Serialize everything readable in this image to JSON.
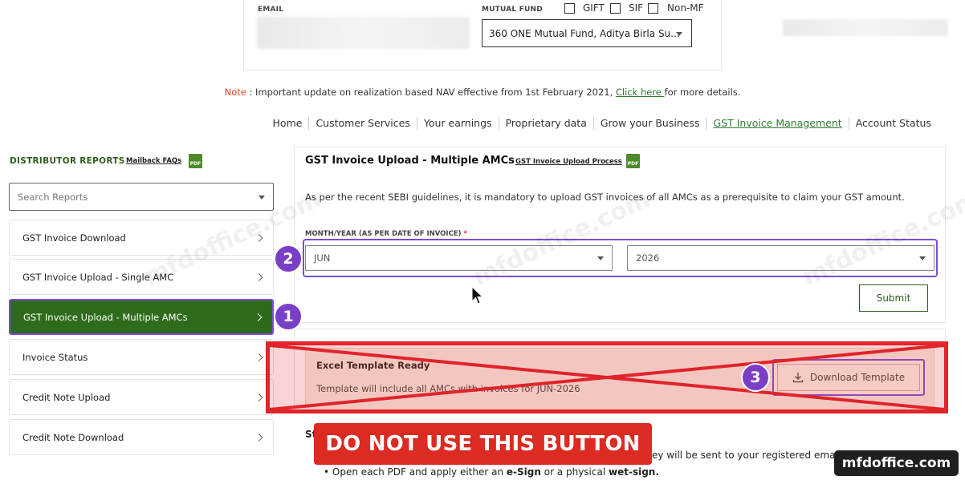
{
  "filters": {
    "email_label": "EMAIL",
    "mutual_fund_label": "MUTUAL FUND",
    "checkboxes": [
      "GIFT",
      "SIF",
      "Non-MF"
    ],
    "mutual_fund_value": "360 ONE Mutual Fund, Aditya Birla Su..."
  },
  "note": {
    "prefix": "Note",
    "text": " : Important update on realization based NAV effective from 1st February 2021, ",
    "link": "Click here ",
    "suffix": "for more details."
  },
  "nav": {
    "items": [
      "Home",
      "Customer Services",
      "Your earnings",
      "Proprietary data",
      "Grow your Business",
      "GST Invoice Management",
      "Account Status"
    ],
    "active": "GST Invoice Management"
  },
  "sidebar": {
    "title": "DISTRIBUTOR REPORTS",
    "faq_link": "Mailback FAQs",
    "pdf_label": "PDF",
    "search_placeholder": "Search Reports",
    "items": [
      {
        "label": "GST Invoice Download"
      },
      {
        "label": "GST Invoice Upload - Single AMC"
      },
      {
        "label": "GST Invoice Upload - Multiple AMCs"
      },
      {
        "label": "Invoice Status"
      },
      {
        "label": "Credit Note Upload"
      },
      {
        "label": "Credit Note Download"
      }
    ],
    "active_index": 2
  },
  "main": {
    "title": "GST Invoice Upload - Multiple AMCs",
    "process_link": "GST Invoice Upload Process",
    "guideline": "As per the recent SEBI guidelines, it is mandatory to upload GST invoices of all AMCs as a prerequisite to claim your GST amount.",
    "field_label": "MONTH/YEAR (AS PER DATE OF INVOICE)",
    "required_mark": "*",
    "month_value": "JUN",
    "year_value": "2026",
    "submit_label": "Submit"
  },
  "template": {
    "title": "Excel Template Ready",
    "subtitle": "Template will include all AMCs with invoices for JUN-2026",
    "download_label": "Download Template"
  },
  "annotations": {
    "badge1": "1",
    "badge2": "2",
    "badge3": "3",
    "warning": "DO NOT USE THIS BUTTON"
  },
  "bottom": {
    "heading_fragment": "St",
    "email_fragment": "ey will be sent to your registered email.",
    "bullet_pre": "Open each PDF and apply either an ",
    "bullet_bold1": "e-Sign",
    "bullet_mid": " or a physical ",
    "bullet_bold2": "wet-sign."
  },
  "watermark": {
    "text": "mfdoffice.com"
  },
  "colors": {
    "brand_green": "#2f6b1c",
    "annotation_purple": "#7a4dd6",
    "warning_red": "#db2b22"
  }
}
